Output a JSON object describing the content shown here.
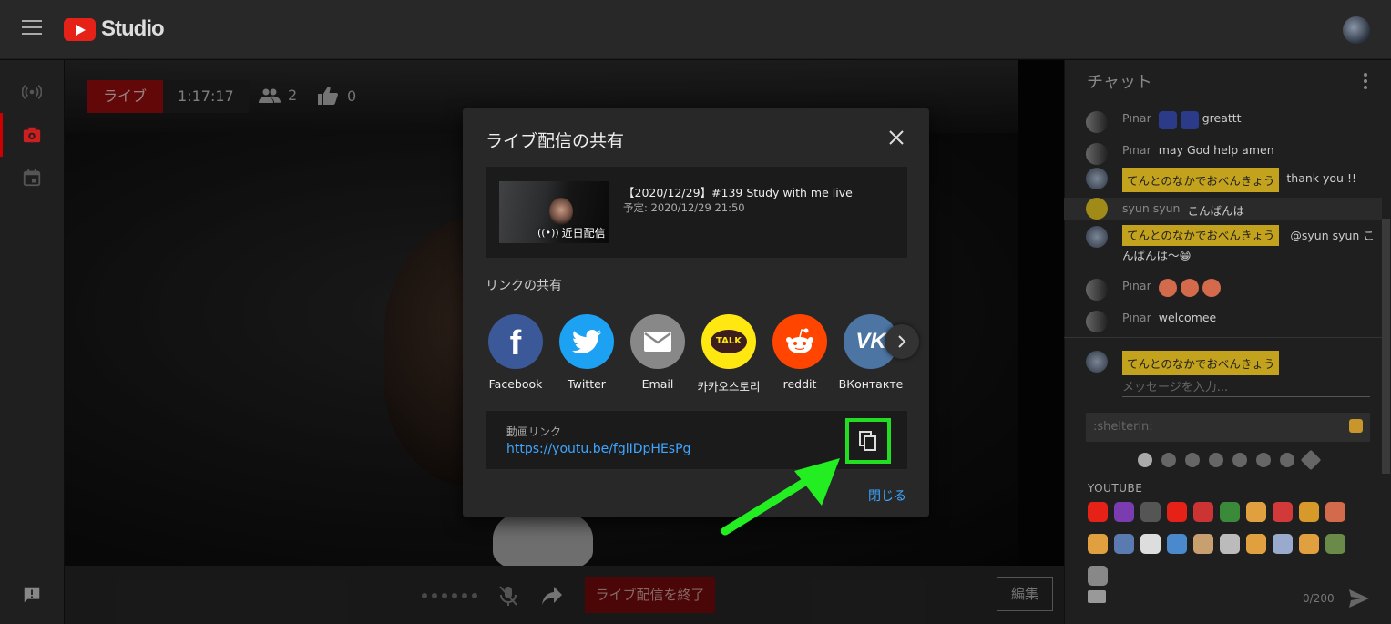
{
  "header": {
    "logo_text": "Studio"
  },
  "live": {
    "label": "ライブ",
    "time": "1:17:17",
    "viewers": "2",
    "likes": "0"
  },
  "controls": {
    "end_live": "ライブ配信を終了",
    "edit": "編集"
  },
  "chat": {
    "title": "チャット",
    "messages": [
      {
        "name": "Pınar",
        "text": "greattt",
        "highlight": false,
        "emoji_prefix": 2
      },
      {
        "name": "Pınar",
        "text": "may God help amen",
        "highlight": false
      },
      {
        "name": "てんとのなかでおべんきょう",
        "text": "thank you !!",
        "highlight": true
      },
      {
        "name": "syun syun",
        "text": "こんばんは",
        "highlight": false
      },
      {
        "name": "てんとのなかでおべんきょう",
        "text": "@syun syun こんばんは〜😁",
        "highlight": true
      },
      {
        "name": "Pınar",
        "text": "",
        "highlight": false,
        "emoji_prefix": 3
      },
      {
        "name": "Pınar",
        "text": "welcomee",
        "highlight": false
      }
    ],
    "composer_name": "てんとのなかでおべんきょう",
    "input_placeholder": "メッセージを入力...",
    "emoji_search": ":shelterin:",
    "emoji_section": "YOUTUBE",
    "char_count": "0/200"
  },
  "modal": {
    "title": "ライブ配信の共有",
    "stream_title": "【2020/12/29】#139 Study with me live",
    "stream_schedule": "予定: 2020/12/29 21:50",
    "thumb_badge": "近日配信",
    "share_label": "リンクの共有",
    "share_targets": [
      {
        "name": "Facebook",
        "color": "#3b5998"
      },
      {
        "name": "Twitter",
        "color": "#1da1f2"
      },
      {
        "name": "Email",
        "color": "#888888"
      },
      {
        "name": "카카오스토리",
        "color": "#ffe812"
      },
      {
        "name": "reddit",
        "color": "#ff4500"
      },
      {
        "name": "ВКонтакте",
        "color": "#4c75a3"
      }
    ],
    "link_label": "動画リンク",
    "link_url": "https://youtu.be/fglIDpHEsPg",
    "close_label": "閉じる"
  },
  "colors": {
    "accent_highlight": "#22dd22",
    "live_red": "#a00e10",
    "link_blue": "#3ea6ff"
  }
}
